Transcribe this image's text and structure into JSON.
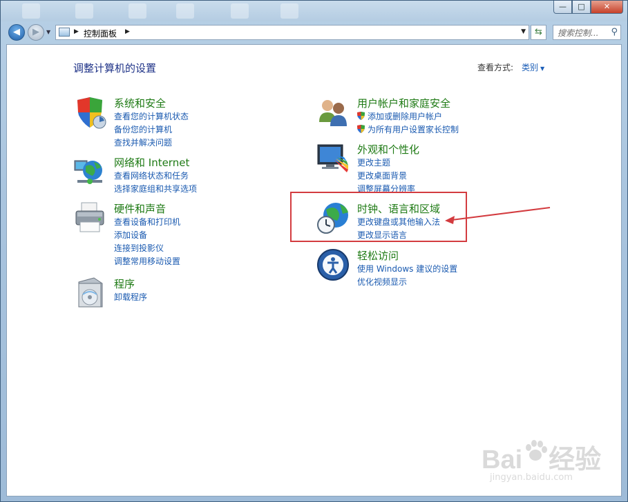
{
  "window": {
    "min_label": "—",
    "max_label": "□",
    "close_label": "✕"
  },
  "nav": {
    "back_icon": "arrow-left-icon",
    "forward_icon": "arrow-right-icon",
    "address_crumb": "控制面板",
    "search_placeholder": "搜索控制..."
  },
  "content": {
    "heading": "调整计算机的设置",
    "view_by_label": "查看方式:",
    "view_by_value": "类别"
  },
  "categories_left": [
    {
      "title": "系统和安全",
      "icon": "shield-icon",
      "links": [
        "查看您的计算机状态",
        "备份您的计算机",
        "查找并解决问题"
      ]
    },
    {
      "title": "网络和 Internet",
      "icon": "network-globe-icon",
      "links": [
        "查看网络状态和任务",
        "选择家庭组和共享选项"
      ]
    },
    {
      "title": "硬件和声音",
      "icon": "printer-icon",
      "links": [
        "查看设备和打印机",
        "添加设备",
        "连接到投影仪",
        "调整常用移动设置"
      ]
    },
    {
      "title": "程序",
      "icon": "programs-disc-icon",
      "links": [
        "卸载程序"
      ]
    }
  ],
  "categories_right": [
    {
      "title": "用户帐户和家庭安全",
      "icon": "users-icon",
      "links": [
        "添加或删除用户帐户",
        "为所有用户设置家长控制"
      ]
    },
    {
      "title": "外观和个性化",
      "icon": "monitor-palette-icon",
      "links": [
        "更改主题",
        "更改桌面背景",
        "调整屏幕分辨率"
      ]
    },
    {
      "title": "时钟、语言和区域",
      "icon": "clock-globe-icon",
      "links": [
        "更改键盘或其他输入法",
        "更改显示语言"
      ]
    },
    {
      "title": "轻松访问",
      "icon": "ease-of-access-icon",
      "links": [
        "使用 Windows 建议的设置",
        "优化视频显示"
      ]
    }
  ],
  "watermark": {
    "brand": "Bai",
    "brand_suffix": "经验",
    "url": "jingyan.baidu.com"
  },
  "colors": {
    "link": "#1a5ab0",
    "category_title": "#1e7a14",
    "heading": "#1e3287",
    "highlight": "#d33b3f"
  }
}
